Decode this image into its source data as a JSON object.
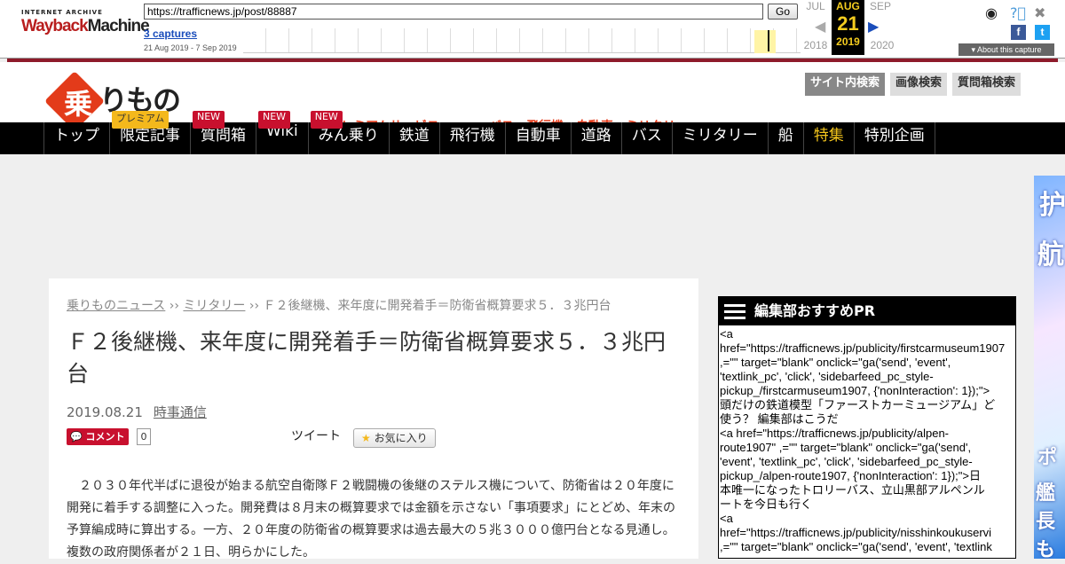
{
  "wayback": {
    "logo_top": "INTERNET ARCHIVE",
    "logo_main_a": "Wayback",
    "logo_main_b": "Machine",
    "url": "https://trafficnews.jp/post/88887",
    "go_label": "Go",
    "captures": "3 captures",
    "range": "21 Aug 2019 - 7 Sep 2019",
    "months": [
      {
        "label": "JUL",
        "year": "2018"
      },
      {
        "label": "AUG",
        "day": "21",
        "year": "2019"
      },
      {
        "label": "SEP",
        "year": "2020"
      }
    ],
    "about": "About this capture",
    "fb": "f",
    "tw": "t"
  },
  "site": {
    "logo_kanji": "乗",
    "logo_text": "りもの",
    "search_tabs": [
      "サイト内検索",
      "画像検索",
      "質問箱検索"
    ],
    "nav_ghost": "プレミアムサービス　　　　バス　飛行機　自動車　ミリタリー",
    "nav": [
      {
        "label": "トップ"
      },
      {
        "label": "限定記事",
        "badge": "プレミアム"
      },
      {
        "label": "質問箱",
        "badge": "NEW"
      },
      {
        "label": "Wiki",
        "badge": "NEW"
      },
      {
        "label": "みん乗り",
        "badge": "NEW"
      },
      {
        "label": "鉄道"
      },
      {
        "label": "飛行機"
      },
      {
        "label": "自動車"
      },
      {
        "label": "道路"
      },
      {
        "label": "バス"
      },
      {
        "label": "ミリタリー"
      },
      {
        "label": "船"
      },
      {
        "label": "特集"
      },
      {
        "label": "特別企画"
      }
    ]
  },
  "article": {
    "breadcrumb": [
      "乗りものニュース",
      "ミリタリー",
      "Ｆ２後継機、来年度に開発着手＝防衛省概算要求５．３兆円台"
    ],
    "sep": " ›› ",
    "title": "Ｆ２後継機、来年度に開発着手＝防衛省概算要求５．３兆円台",
    "date": "2019.08.21",
    "source": "時事通信",
    "comment_label": "コメント",
    "comment_count": "0",
    "tweet": "ツイート",
    "fav": "お気に入り",
    "body": "２０３０年代半ばに退役が始まる航空自衛隊Ｆ２戦闘機の後継のステルス機について、防衛省は２０年度に開発に着手する調整に入った。開発費は８月末の概算要求では金額を示さない「事項要求」にとどめ、年末の予算編成時に算出する。一方、２０年度の防衛省の概算要求は過去最大の５兆３０００億円台となる見通し。複数の政府関係者が２１日、明らかにした。"
  },
  "sidebar": {
    "title": "編集部おすすめPR",
    "raw": "<a\nhref=\"https://trafficnews.jp/publicity/firstcarmuseum1907\n,=\"\" target=\"blank\" onclick=\"ga('send', 'event',\n'textlink_pc', 'click', 'sidebarfeed_pc_style-\npickup_/firstcarmuseum1907, {'nonInteraction': 1});\">\n頭だけの鉄道模型「ファーストカーミュージアム」ど\n使う？ 編集部はこうだ\n<a href=\"https://trafficnews.jp/publicity/alpen-\nroute1907\" ,=\"\" target=\"blank\" onclick=\"ga('send',\n'event', 'textlink_pc', 'click', 'sidebarfeed_pc_style-\npickup_/alpen-route1907, {'nonInteraction': 1});\">日\n本唯一になったトロリーバス、立山黒部アルペンル\nートを今日も行く\n<a\nhref=\"https://trafficnews.jp/publicity/nisshinkoukuservi\n,=\"\" target=\"blank\" onclick=\"ga('send', 'event', 'textlink"
  },
  "ad": {
    "chars": [
      "护",
      "航",
      "ポ",
      "艦",
      "長も"
    ]
  }
}
